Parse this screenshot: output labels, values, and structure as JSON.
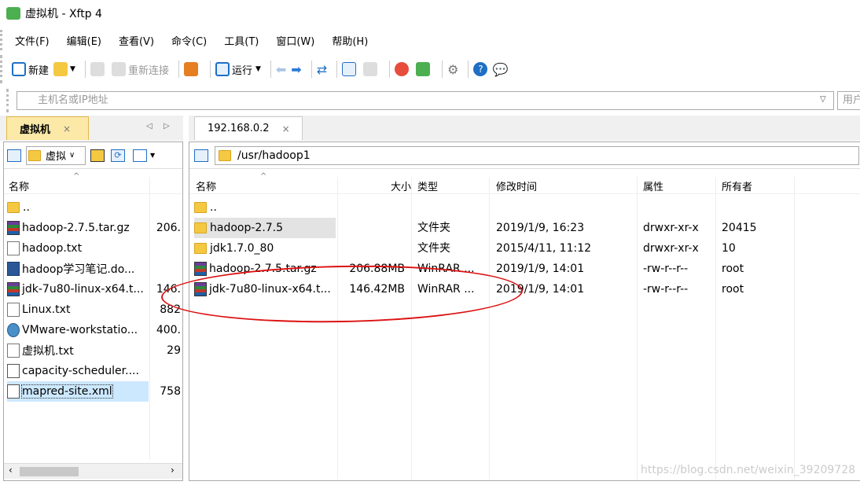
{
  "window": {
    "title": "虚拟机 - Xftp 4"
  },
  "menu": [
    "文件(F)",
    "编辑(E)",
    "查看(V)",
    "命令(C)",
    "工具(T)",
    "窗口(W)",
    "帮助(H)"
  ],
  "toolbar": {
    "new_label": "新建",
    "reconnect_label": "重新连接",
    "run_label": "运行"
  },
  "address": {
    "placeholder": "主机名或IP地址",
    "user_placeholder": "用户名"
  },
  "left": {
    "tab_label": "虚拟机",
    "tab_close": "×",
    "path": "虚拟",
    "columns": {
      "name": "名称"
    },
    "files": [
      {
        "name": "..",
        "size": "",
        "icon": "folder-icon"
      },
      {
        "name": "hadoop-2.7.5.tar.gz",
        "size": "206.",
        "icon": "rar-icon"
      },
      {
        "name": "hadoop.txt",
        "size": "",
        "icon": "txt-icon"
      },
      {
        "name": "hadoop学习笔记.do...",
        "size": "",
        "icon": "word-icon"
      },
      {
        "name": "jdk-7u80-linux-x64.t...",
        "size": "146.",
        "icon": "rar-icon"
      },
      {
        "name": "Linux.txt",
        "size": "882",
        "icon": "txt-icon"
      },
      {
        "name": "VMware-workstatio...",
        "size": "400.",
        "icon": "vmware-icon"
      },
      {
        "name": "虚拟机.txt",
        "size": "29",
        "icon": "txt-icon"
      },
      {
        "name": "capacity-scheduler....",
        "size": "",
        "icon": "xml-icon"
      },
      {
        "name": "mapred-site.xml",
        "size": "758",
        "icon": "xml-icon"
      }
    ]
  },
  "right": {
    "tab_label": "192.168.0.2",
    "tab_close": "×",
    "path": "/usr/hadoop1",
    "columns": {
      "name": "名称",
      "size": "大小",
      "type": "类型",
      "modified": "修改时间",
      "attr": "属性",
      "owner": "所有者"
    },
    "files": [
      {
        "name": "..",
        "size": "",
        "type": "",
        "modified": "",
        "attr": "",
        "owner": "",
        "icon": "folder-icon"
      },
      {
        "name": "hadoop-2.7.5",
        "size": "",
        "type": "文件夹",
        "modified": "2019/1/9, 16:23",
        "attr": "drwxr-xr-x",
        "owner": "20415",
        "icon": "folder-icon"
      },
      {
        "name": "jdk1.7.0_80",
        "size": "",
        "type": "文件夹",
        "modified": "2015/4/11, 11:12",
        "attr": "drwxr-xr-x",
        "owner": "10",
        "icon": "folder-icon"
      },
      {
        "name": "hadoop-2.7.5.tar.gz",
        "size": "206.88MB",
        "type": "WinRAR ...",
        "modified": "2019/1/9, 14:01",
        "attr": "-rw-r--r--",
        "owner": "root",
        "icon": "rar-icon"
      },
      {
        "name": "jdk-7u80-linux-x64.t...",
        "size": "146.42MB",
        "type": "WinRAR ...",
        "modified": "2019/1/9, 14:01",
        "attr": "-rw-r--r--",
        "owner": "root",
        "icon": "rar-icon"
      }
    ]
  },
  "watermark": "https://blog.csdn.net/weixin_39209728",
  "colors": {
    "selection": "#cce8ff",
    "annotation": "#dd1111",
    "folder": "#f5c842"
  }
}
